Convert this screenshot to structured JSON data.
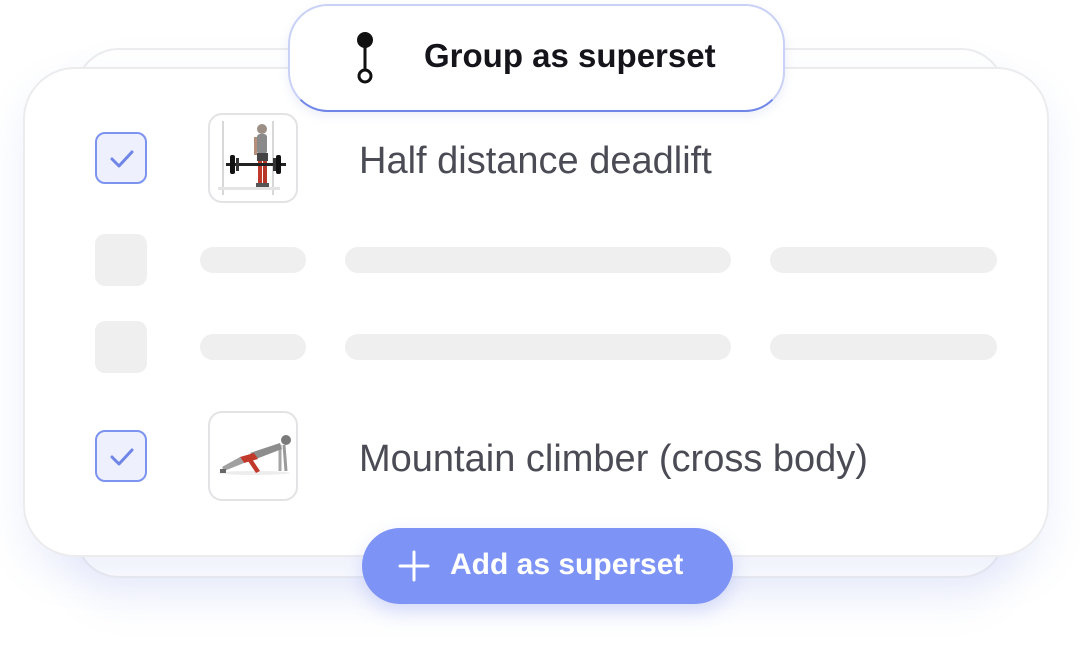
{
  "header": {
    "group_label": "Group as superset",
    "icon": "superset-link-icon"
  },
  "exercises": [
    {
      "name": "Half distance deadlift",
      "checked": true,
      "icon": "deadlift-figure"
    },
    {
      "name": "Mountain climber (cross body)",
      "checked": true,
      "icon": "mountain-climber-figure"
    }
  ],
  "placeholder_rows": 2,
  "footer": {
    "add_label": "Add as superset",
    "icon": "plus-icon"
  },
  "colors": {
    "accent": "#7d93f5",
    "checkbox_border": "#7d93f0",
    "checkbox_fill": "#eef1fd",
    "skeleton": "#efefef",
    "text": "#4b4b55"
  }
}
